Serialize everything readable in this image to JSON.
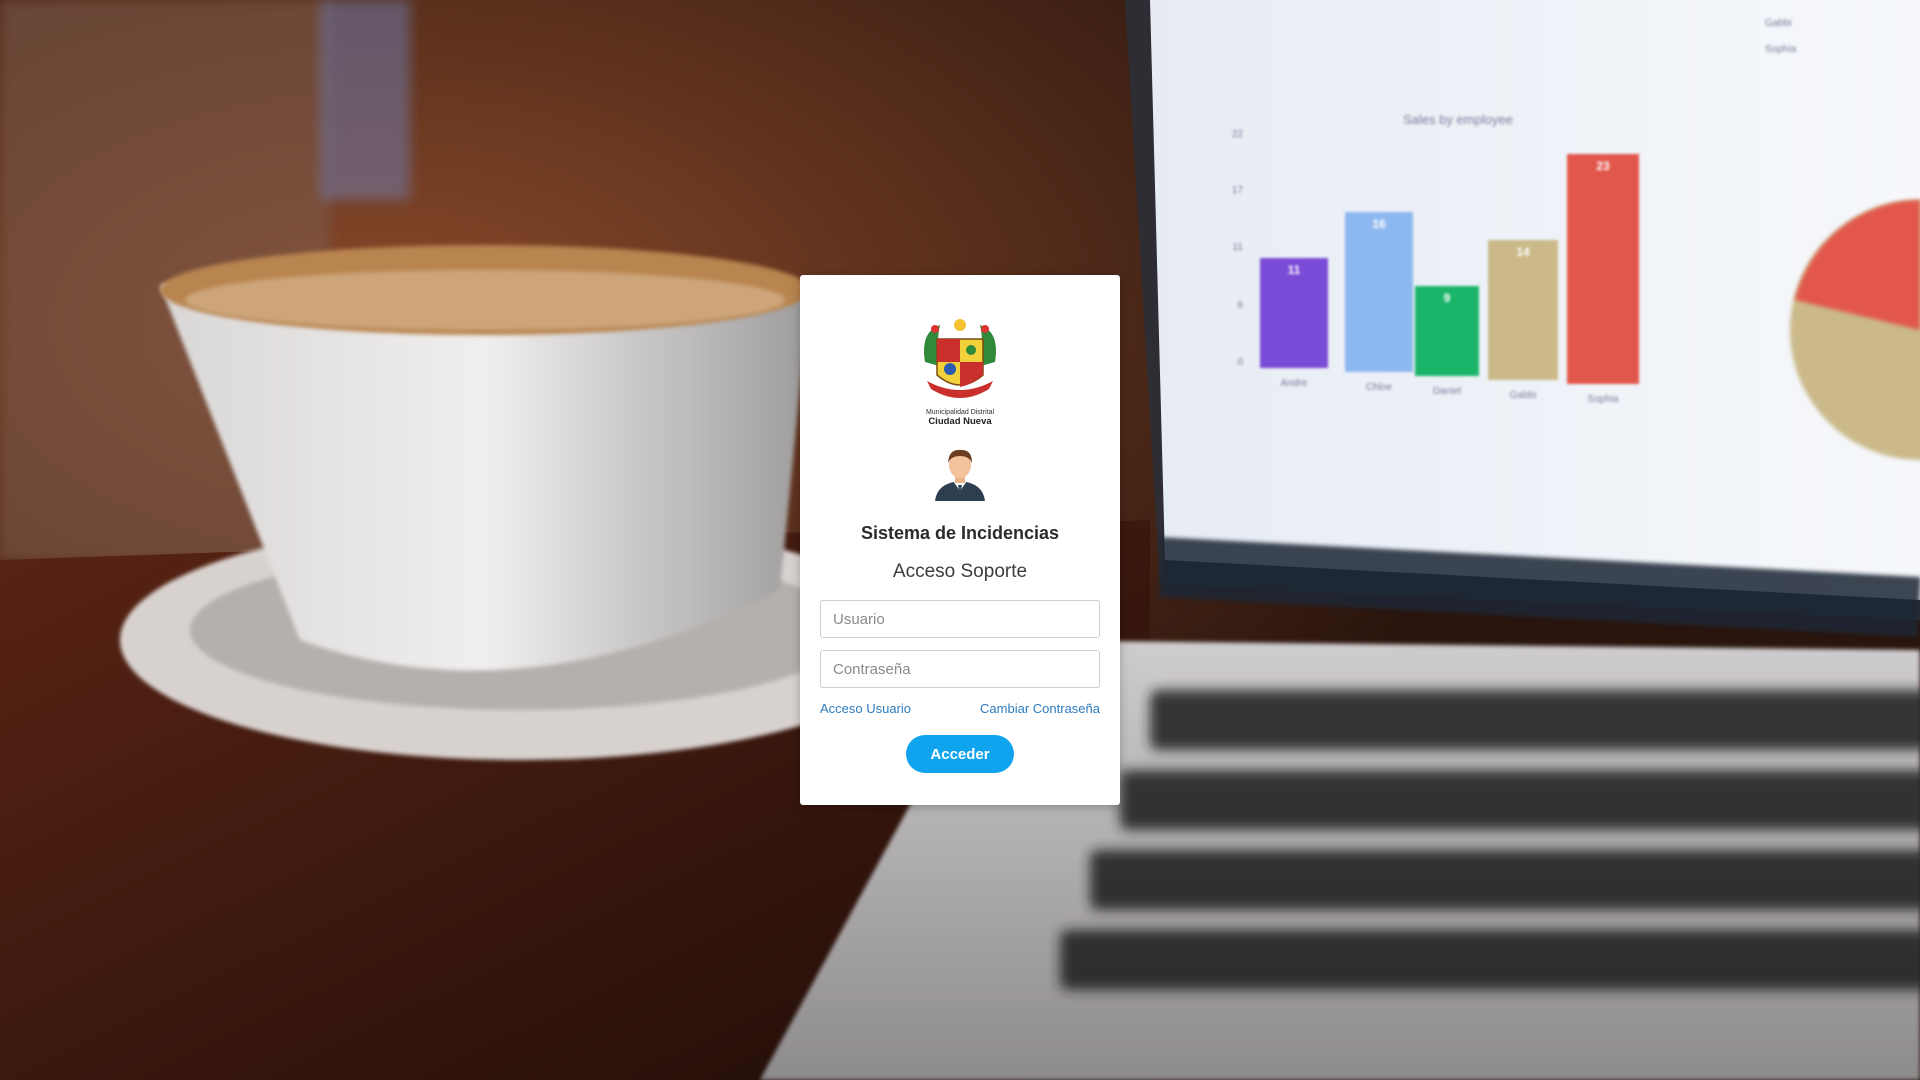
{
  "login": {
    "logo_line1": "Municipalidad Distrital",
    "logo_line2": "Ciudad Nueva",
    "title": "Sistema de Incidencias",
    "subtitle": "Acceso Soporte",
    "username_placeholder": "Usuario",
    "password_placeholder": "Contraseña",
    "link_user_access": "Acceso Usuario",
    "link_change_password": "Cambiar Contraseña",
    "submit_label": "Acceder"
  },
  "background": {
    "description_icon": "coffee-laptop-photo",
    "chart_title": "Sales by employee",
    "chart_ticks": [
      "22",
      "17",
      "11",
      "6",
      "0"
    ],
    "chart_bars": [
      {
        "label": "Andre",
        "value": "11",
        "color": "#7a4bd6"
      },
      {
        "label": "Chloe",
        "value": "16",
        "color": "#8db8ef"
      },
      {
        "label": "Daniel",
        "value": "9",
        "color": "#1bb56a"
      },
      {
        "label": "Gabbi",
        "value": "14",
        "color": "#cbb98a"
      },
      {
        "label": "Sophia",
        "value": "23",
        "color": "#e2574c"
      }
    ],
    "legend_items": [
      "Gabbi",
      "Sophia"
    ]
  },
  "colors": {
    "accent": "#10a3ee",
    "link": "#2c7bbf"
  }
}
